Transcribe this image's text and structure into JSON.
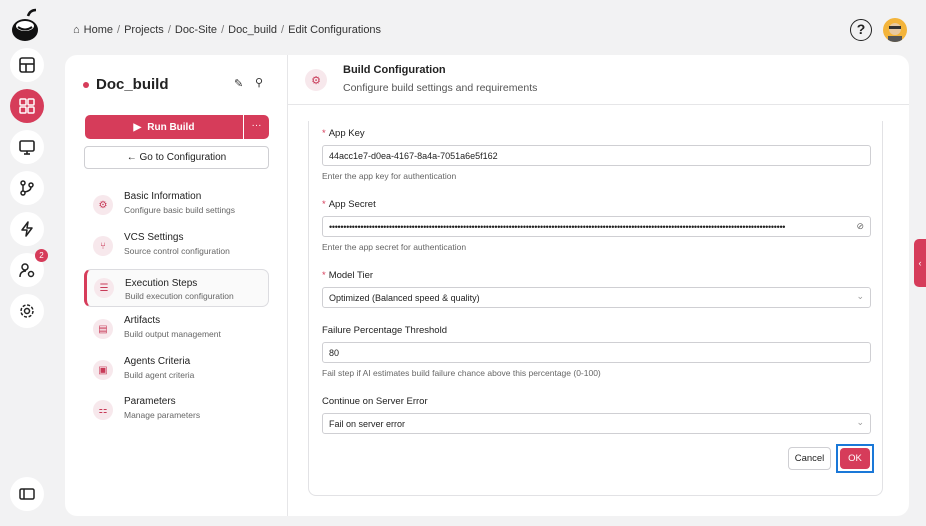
{
  "breadcrumb": {
    "items": [
      "Home",
      "Projects",
      "Doc-Site",
      "Doc_build",
      "Edit Configurations"
    ],
    "separator": "/"
  },
  "rail": {
    "badge_count": "2",
    "icons": [
      "logo-icon",
      "table-icon",
      "dashboard-icon",
      "monitor-icon",
      "git-branch-icon",
      "lightning-icon",
      "user-settings-icon",
      "settings-icon",
      "sidebar-toggle-icon"
    ]
  },
  "sidebar": {
    "project_name": "Doc_build",
    "run_build": "Run Build",
    "more": "···",
    "goto_config": "← Go to Configuration",
    "items": [
      {
        "title": "Basic Information",
        "subtitle": "Configure basic build settings"
      },
      {
        "title": "VCS Settings",
        "subtitle": "Source control configuration"
      },
      {
        "title": "Execution Steps",
        "subtitle": "Build execution configuration"
      },
      {
        "title": "Artifacts",
        "subtitle": "Build output management"
      },
      {
        "title": "Agents Criteria",
        "subtitle": "Build agent criteria"
      },
      {
        "title": "Parameters",
        "subtitle": "Manage parameters"
      }
    ]
  },
  "header": {
    "title": "Build Configuration",
    "subtitle": "Configure build settings and requirements"
  },
  "form": {
    "app_key": {
      "label": "App Key",
      "value": "44acc1e7-d0ea-4167-8a4a-7051a6e5f162",
      "hint": "Enter the app key for authentication"
    },
    "app_secret": {
      "label": "App Secret",
      "value": "••••••••••••••••••••••••••••••••••••••••••••••••••••••••••••••••••••••••••••••••••••••••••••••••••••••••••••••••••••••••••••••••••••••••••••••••••••••••••••••••",
      "hint": "Enter the app secret for authentication"
    },
    "model_tier": {
      "label": "Model Tier",
      "value": "Optimized (Balanced speed & quality)"
    },
    "failure_threshold": {
      "label": "Failure Percentage Threshold",
      "value": "80",
      "hint": "Fail step if AI estimates build failure chance above this percentage (0-100)"
    },
    "server_error": {
      "label": "Continue on Server Error",
      "value": "Fail on server error"
    },
    "cancel": "Cancel",
    "ok": "OK"
  },
  "colors": {
    "accent": "#d63c5a",
    "focus": "#1a78d8"
  }
}
